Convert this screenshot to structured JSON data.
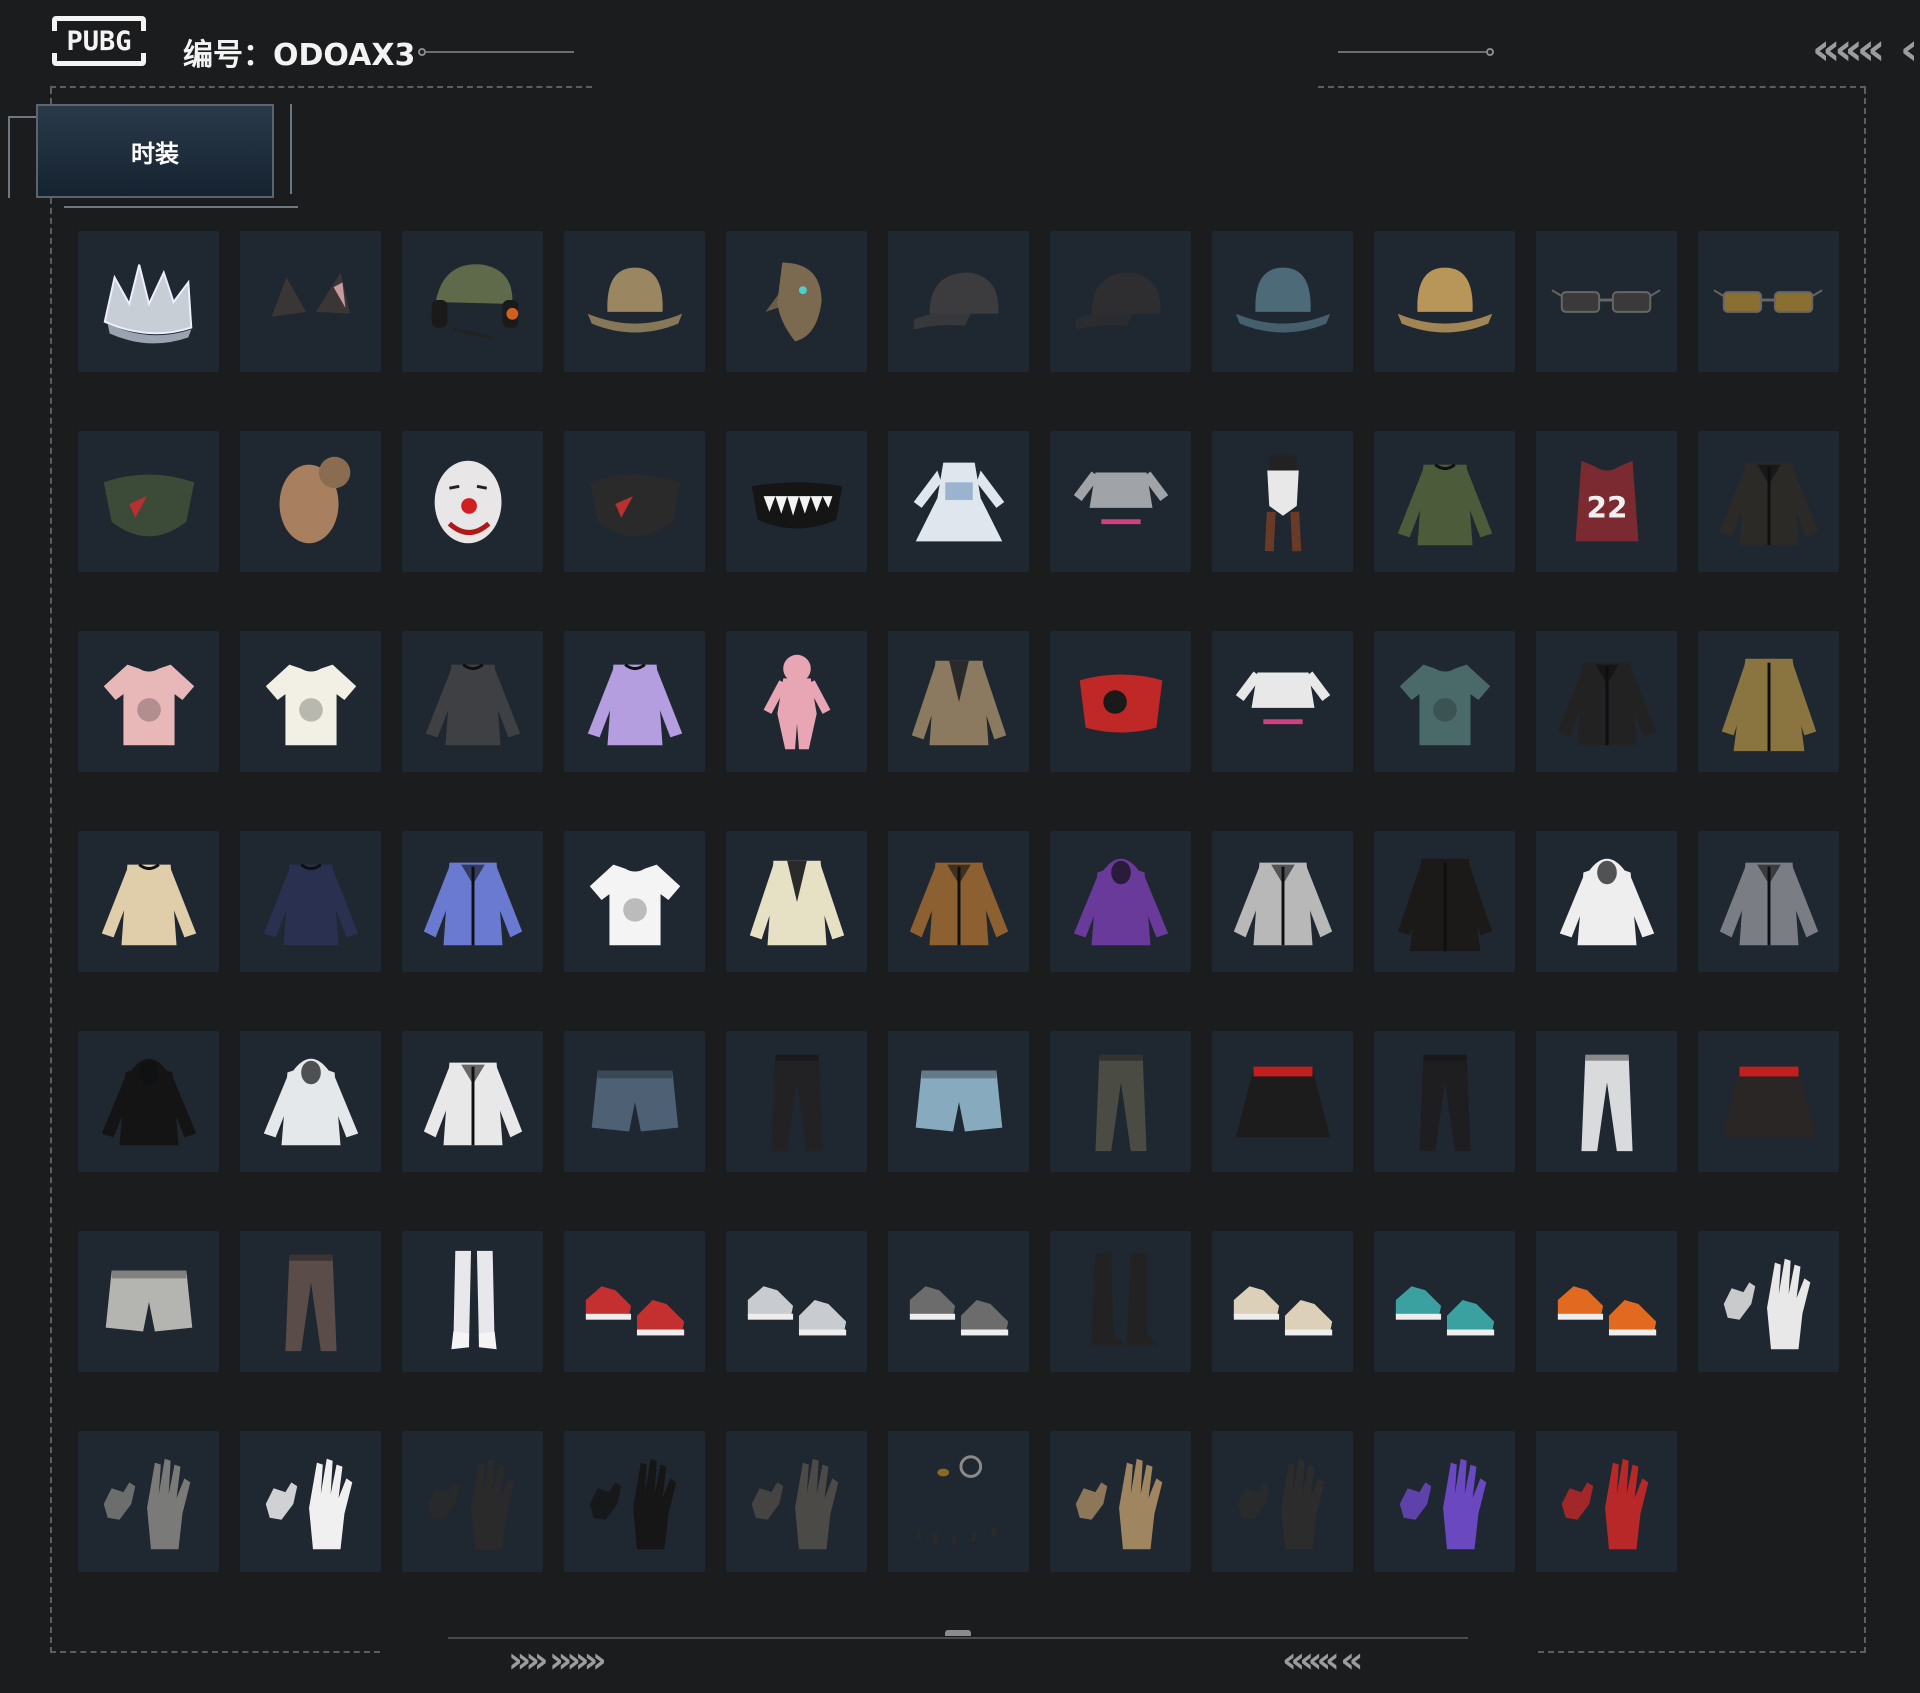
{
  "header": {
    "logo_text": "PUBG",
    "code_label": "编号：ODOAX3"
  },
  "tab": {
    "label": "时装"
  },
  "decor": {
    "chevrons_top_right": "«««",
    "chevrons_bottom_left": "»» »»»",
    "chevrons_bottom_right": "«««  «"
  },
  "colors": {
    "background": "#1b1c1e",
    "tile": "#1f2731",
    "frame": "#5d5e60",
    "tab_top": "#2a3a4a",
    "tab_bottom": "#152230"
  },
  "items": [
    {
      "name": "crown",
      "icon": "crown-icon",
      "color": "#c8ced6"
    },
    {
      "name": "cat-ears",
      "icon": "cat-ears-icon",
      "color": "#3a3636"
    },
    {
      "name": "military-helmet-headset",
      "icon": "helmet-icon",
      "color": "#5f6a4a"
    },
    {
      "name": "leopard-bucket-hat",
      "icon": "bucket-hat-icon",
      "color": "#9a8660"
    },
    {
      "name": "bird-mask",
      "icon": "mask-icon",
      "color": "#7c6a50"
    },
    {
      "name": "black-cap",
      "icon": "cap-icon",
      "color": "#3c3c3e"
    },
    {
      "name": "black-cap-logo",
      "icon": "cap-icon",
      "color": "#2e2e30"
    },
    {
      "name": "blue-bucket-hat",
      "icon": "bucket-hat-icon",
      "color": "#4c6a78"
    },
    {
      "name": "gold-bucket-hat",
      "icon": "bucket-hat-icon",
      "color": "#b8965a"
    },
    {
      "name": "tech-glasses",
      "icon": "glasses-icon",
      "color": "#3a3a3a"
    },
    {
      "name": "gold-sunglasses",
      "icon": "glasses-icon",
      "color": "#8a7030"
    },
    {
      "name": "camo-face-mask",
      "icon": "face-mask-icon",
      "color": "#3c4a38"
    },
    {
      "name": "realistic-head-mask",
      "icon": "head-icon",
      "color": "#a88060"
    },
    {
      "name": "clown-mask",
      "icon": "clown-mask-icon",
      "color": "#e8e6e6"
    },
    {
      "name": "red-bandana",
      "icon": "face-mask-icon",
      "color": "#2a2a2a"
    },
    {
      "name": "shark-teeth-mask",
      "icon": "teeth-mask-icon",
      "color": "#151515"
    },
    {
      "name": "maid-dress",
      "icon": "dress-icon",
      "color": "#dfe6ee"
    },
    {
      "name": "white-crop-top",
      "icon": "crop-top-icon",
      "color": "#a0a4a8"
    },
    {
      "name": "bunny-bodysuit",
      "icon": "bodysuit-icon",
      "color": "#e8e8e8"
    },
    {
      "name": "green-turtleneck",
      "icon": "sweater-icon",
      "color": "#4c5c3a"
    },
    {
      "name": "jersey-22",
      "icon": "jersey-icon",
      "color": "#7a2a30"
    },
    {
      "name": "black-gold-jacket",
      "icon": "jacket-icon",
      "color": "#2c2a26"
    },
    {
      "name": "pink-tshirt",
      "icon": "tshirt-icon",
      "color": "#e8b8b8"
    },
    {
      "name": "yellow-raglan-tshirt",
      "icon": "tshirt-icon",
      "color": "#f2f0e4"
    },
    {
      "name": "tactical-long-sleeve",
      "icon": "sweater-icon",
      "color": "#3e4044"
    },
    {
      "name": "purple-owl-sweater",
      "icon": "sweater-icon",
      "color": "#b49ee0"
    },
    {
      "name": "pink-onesie",
      "icon": "onesie-icon",
      "color": "#e8a6b4"
    },
    {
      "name": "patterned-blazer",
      "icon": "blazer-icon",
      "color": "#8c7a60"
    },
    {
      "name": "red-cat-tube-top",
      "icon": "tube-top-icon",
      "color": "#c02828"
    },
    {
      "name": "sports-bra-arms",
      "icon": "crop-top-icon",
      "color": "#e8e8e8"
    },
    {
      "name": "floral-shirt",
      "icon": "tshirt-icon",
      "color": "#4a6a6a"
    },
    {
      "name": "black-leather-jacket",
      "icon": "jacket-icon",
      "color": "#222222"
    },
    {
      "name": "leopard-coat",
      "icon": "coat-icon",
      "color": "#8a7440"
    },
    {
      "name": "cream-cardigan",
      "icon": "sweater-icon",
      "color": "#e0ceaa"
    },
    {
      "name": "navy-anniversary-sweater",
      "icon": "sweater-icon",
      "color": "#2a3050"
    },
    {
      "name": "holographic-jacket",
      "icon": "jacket-icon",
      "color": "#6a7ad0"
    },
    {
      "name": "bunny-print-tshirt",
      "icon": "tshirt-icon",
      "color": "#f4f4f4"
    },
    {
      "name": "cream-suit",
      "icon": "blazer-icon",
      "color": "#e6e0c4"
    },
    {
      "name": "brown-puffer",
      "icon": "jacket-icon",
      "color": "#8c6030"
    },
    {
      "name": "purple-hoodie",
      "icon": "hoodie-icon",
      "color": "#6a3a9a"
    },
    {
      "name": "silver-jacket",
      "icon": "jacket-icon",
      "color": "#b8b8b8"
    },
    {
      "name": "black-gold-coat",
      "icon": "coat-icon",
      "color": "#1c1a18"
    },
    {
      "name": "white-bear-hoodie",
      "icon": "hoodie-icon",
      "color": "#eeeeee"
    },
    {
      "name": "grey-orange-jacket",
      "icon": "jacket-icon",
      "color": "#7a7e84"
    },
    {
      "name": "black-aura-hoodie",
      "icon": "hoodie-icon",
      "color": "#141414"
    },
    {
      "name": "white-hoodie",
      "icon": "hoodie-icon",
      "color": "#e4e8ea"
    },
    {
      "name": "orange-white-jacket",
      "icon": "jacket-icon",
      "color": "#e8e8e8"
    },
    {
      "name": "denim-shorts",
      "icon": "shorts-icon",
      "color": "#4e6074"
    },
    {
      "name": "black-leather-pants",
      "icon": "pants-icon",
      "color": "#222224"
    },
    {
      "name": "blue-shorts",
      "icon": "shorts-icon",
      "color": "#88aabe"
    },
    {
      "name": "tactical-cargo-pants",
      "icon": "pants-icon",
      "color": "#4a4c44"
    },
    {
      "name": "polka-skirt",
      "icon": "skirt-icon",
      "color": "#1c1c1c"
    },
    {
      "name": "black-gold-pants",
      "icon": "pants-icon",
      "color": "#1e1e20"
    },
    {
      "name": "white-jeans",
      "icon": "pants-icon",
      "color": "#d8dadc"
    },
    {
      "name": "leather-skirt-red",
      "icon": "skirt-icon",
      "color": "#2a2626"
    },
    {
      "name": "grey-cargo-shorts",
      "icon": "shorts-icon",
      "color": "#b4b4b0"
    },
    {
      "name": "camo-pants",
      "icon": "pants-icon",
      "color": "#5a4c48"
    },
    {
      "name": "white-stockings-boots",
      "icon": "stockings-icon",
      "color": "#e8e8ec"
    },
    {
      "name": "red-sneakers",
      "icon": "sneakers-icon",
      "color": "#c43030"
    },
    {
      "name": "winged-sneakers",
      "icon": "sneakers-icon",
      "color": "#c8ccd0"
    },
    {
      "name": "grey-orange-sneakers",
      "icon": "sneakers-icon",
      "color": "#6c6c6c"
    },
    {
      "name": "tall-black-boots",
      "icon": "boots-icon",
      "color": "#222222"
    },
    {
      "name": "beige-sneakers",
      "icon": "sneakers-icon",
      "color": "#ddd0b8"
    },
    {
      "name": "teal-clogs",
      "icon": "sneakers-icon",
      "color": "#3aa0a0"
    },
    {
      "name": "orange-high-tops",
      "icon": "sneakers-icon",
      "color": "#e26a20"
    },
    {
      "name": "white-gloves",
      "icon": "gloves-icon",
      "color": "#e8e8e8"
    },
    {
      "name": "grey-fingerless-gloves",
      "icon": "gloves-icon",
      "color": "#7a7a78"
    },
    {
      "name": "racing-gloves",
      "icon": "gloves-icon",
      "color": "#f0f0f0"
    },
    {
      "name": "black-wraps",
      "icon": "gloves-icon",
      "color": "#2a2a2a"
    },
    {
      "name": "black-claw-gloves",
      "icon": "gloves-icon",
      "color": "#161616"
    },
    {
      "name": "leather-studded-gloves",
      "icon": "gloves-icon",
      "color": "#4c4a46"
    },
    {
      "name": "rings-and-nails",
      "icon": "rings-icon",
      "color": "#8a8a8a"
    },
    {
      "name": "golden-gauntlet",
      "icon": "gloves-icon",
      "color": "#a08660"
    },
    {
      "name": "skeleton-gloves",
      "icon": "gloves-icon",
      "color": "#2c2c2c"
    },
    {
      "name": "purple-gloves",
      "icon": "gloves-icon",
      "color": "#6a48c0"
    },
    {
      "name": "red-fingerless-gloves",
      "icon": "gloves-icon",
      "color": "#b82828"
    }
  ]
}
